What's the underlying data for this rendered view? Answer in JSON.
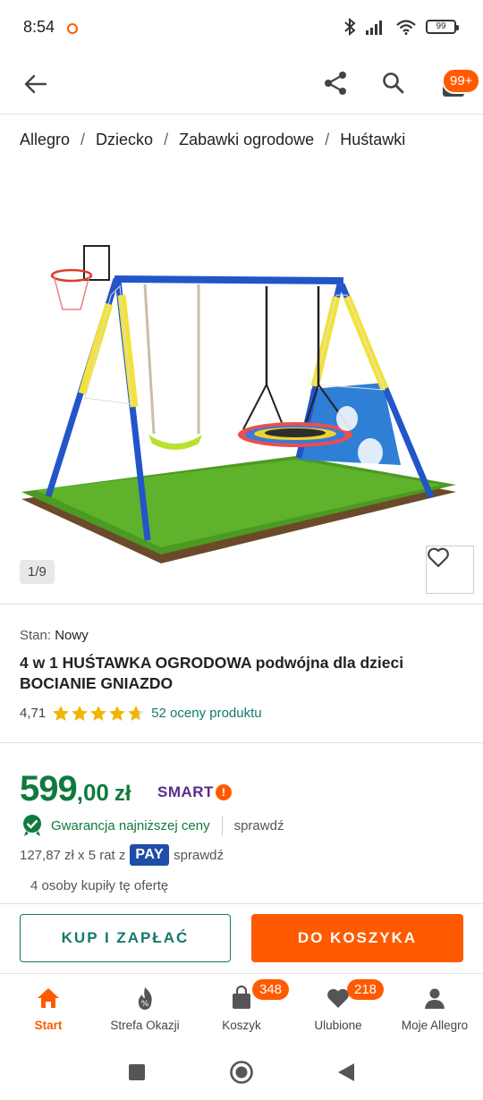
{
  "status_bar": {
    "time": "8:54",
    "battery": "99"
  },
  "header": {
    "cart_badge": "99+"
  },
  "breadcrumb": [
    {
      "label": "Allegro"
    },
    {
      "label": "Dziecko"
    },
    {
      "label": "Zabawki ogrodowe"
    },
    {
      "label": "Huśtawki"
    }
  ],
  "gallery": {
    "counter": "1/9"
  },
  "product": {
    "condition_label": "Stan:",
    "condition_value": "Nowy",
    "title": "4 w 1 HUŚTAWKA OGRODOWA podwójna dla dzieci BOCIANIE GNIAZDO",
    "rating": "4,71",
    "stars": 4.71,
    "reviews": "52 oceny produktu"
  },
  "price": {
    "integer": "599",
    "decimal": ",00",
    "currency": "zł",
    "smart_label": "SMART"
  },
  "guarantee": {
    "text": "Gwarancja najniższej ceny",
    "link": "sprawdź"
  },
  "installments": {
    "text": "127,87 zł x 5 rat z",
    "pay_label": "PAY",
    "link": "sprawdź"
  },
  "buyers": "4 osoby kupiły tę ofertę",
  "actions": {
    "buy_now": "KUP I ZAPŁAĆ",
    "add_to_cart": "DO KOSZYKA"
  },
  "bottom_nav": [
    {
      "label": "Start",
      "icon": "home-icon",
      "active": true
    },
    {
      "label": "Strefa Okazji",
      "icon": "deals-icon"
    },
    {
      "label": "Koszyk",
      "icon": "bag-icon",
      "badge": "348"
    },
    {
      "label": "Ulubione",
      "icon": "heart-icon",
      "badge": "218"
    },
    {
      "label": "Moje Allegro",
      "icon": "user-icon"
    }
  ],
  "colors": {
    "accent": "#ff5a00",
    "price": "#107a3e",
    "link": "#107a6e",
    "pay": "#1f4ea8",
    "smart": "#5a2b8c"
  }
}
